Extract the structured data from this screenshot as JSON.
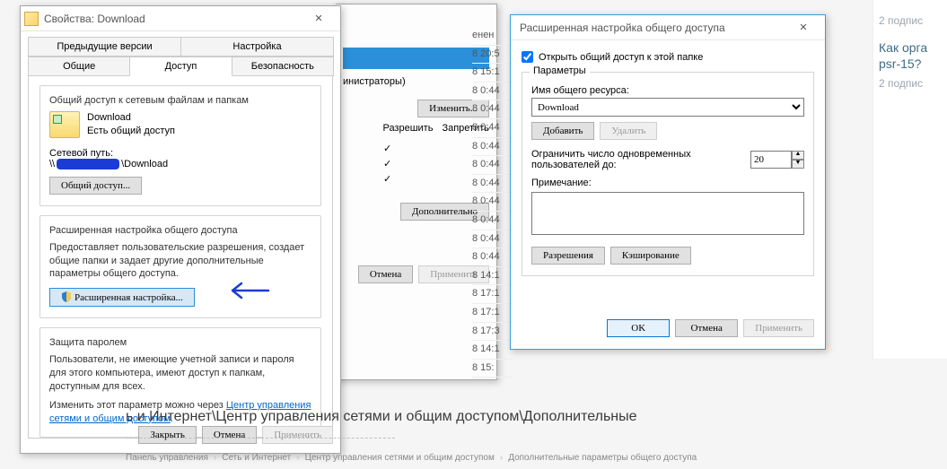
{
  "win1": {
    "title": "Свойства: Download",
    "tabs_row1": [
      "Предыдущие версии",
      "Настройка"
    ],
    "tabs_row2": [
      "Общие",
      "Доступ",
      "Безопасность"
    ],
    "active_tab": "Доступ",
    "netshare": {
      "group_title": "Общий доступ к сетевым файлам и папкам",
      "folder_name": "Download",
      "status": "Есть общий доступ",
      "netpath_label": "Сетевой путь:",
      "netpath_prefix": "\\\\",
      "netpath_suffix": "\\Download",
      "share_btn": "Общий доступ..."
    },
    "adv": {
      "group_title": "Расширенная настройка общего доступа",
      "desc": "Предоставляет пользовательские разрешения, создает общие папки и задает другие дополнительные параметры общего доступа.",
      "btn": "Расширенная настройка..."
    },
    "pwd": {
      "group_title": "Защита паролем",
      "desc": "Пользователи, не имеющие учетной записи и пароля для этого компьютера, имеют доступ к папкам, доступным для всех.",
      "change_pre": "Изменить этот параметр можно через ",
      "link": "Центр управления сетями и общим доступом",
      "dot": "."
    },
    "buttons": {
      "close": "Закрыть",
      "cancel": "Отмена",
      "apply": "Применить"
    }
  },
  "perm": {
    "admins": "инистраторы)",
    "change_btn": "Изменить...",
    "hdr_allow": "Разрешить",
    "hdr_deny": "Запретить",
    "more_btn": "Дополнительно",
    "bottom_cancel": "Отмена",
    "bottom_apply": "Применить"
  },
  "times": [
    "енен",
    "8 20:5",
    "8 15:1",
    "8 0:44",
    "8 0:44",
    "8 0:44",
    "8 0:44",
    "8 0:44",
    "8 0:44",
    "8 0:44",
    "8 0:44",
    "8 0:44",
    "8 0:44",
    "8 14:1",
    "8 17:1",
    "8 17:1",
    "8 17:3",
    "8 14:1",
    "8 15:"
  ],
  "win2": {
    "title": "Расширенная настройка общего доступа",
    "chk_label": "Открыть общий доступ к этой папке",
    "chk_checked": true,
    "params_title": "Параметры",
    "sharename_label": "Имя общего ресурса:",
    "sharename_value": "Download",
    "add_btn": "Добавить",
    "del_btn": "Удалить",
    "limit_label": "Ограничить число одновременных пользователей до:",
    "limit_value": "20",
    "comment_label": "Примечание:",
    "perm_btn": "Разрешения",
    "cache_btn": "Кэширование",
    "ok": "OK",
    "cancel": "Отмена",
    "apply": "Применить"
  },
  "rightside": {
    "sub1": "2 подпис",
    "question": "Как орга",
    "question2": "psr-15?",
    "sub2": "2 подпис"
  },
  "bottom": {
    "path": "ь и Интернет\\Центр управления сетями и общим доступом\\Дополнительные",
    "crumbs": [
      "Панель управления",
      "Сеть и Интернет",
      "Центр управления сетями и общим доступом",
      "Дополнительные параметры общего доступа"
    ]
  }
}
